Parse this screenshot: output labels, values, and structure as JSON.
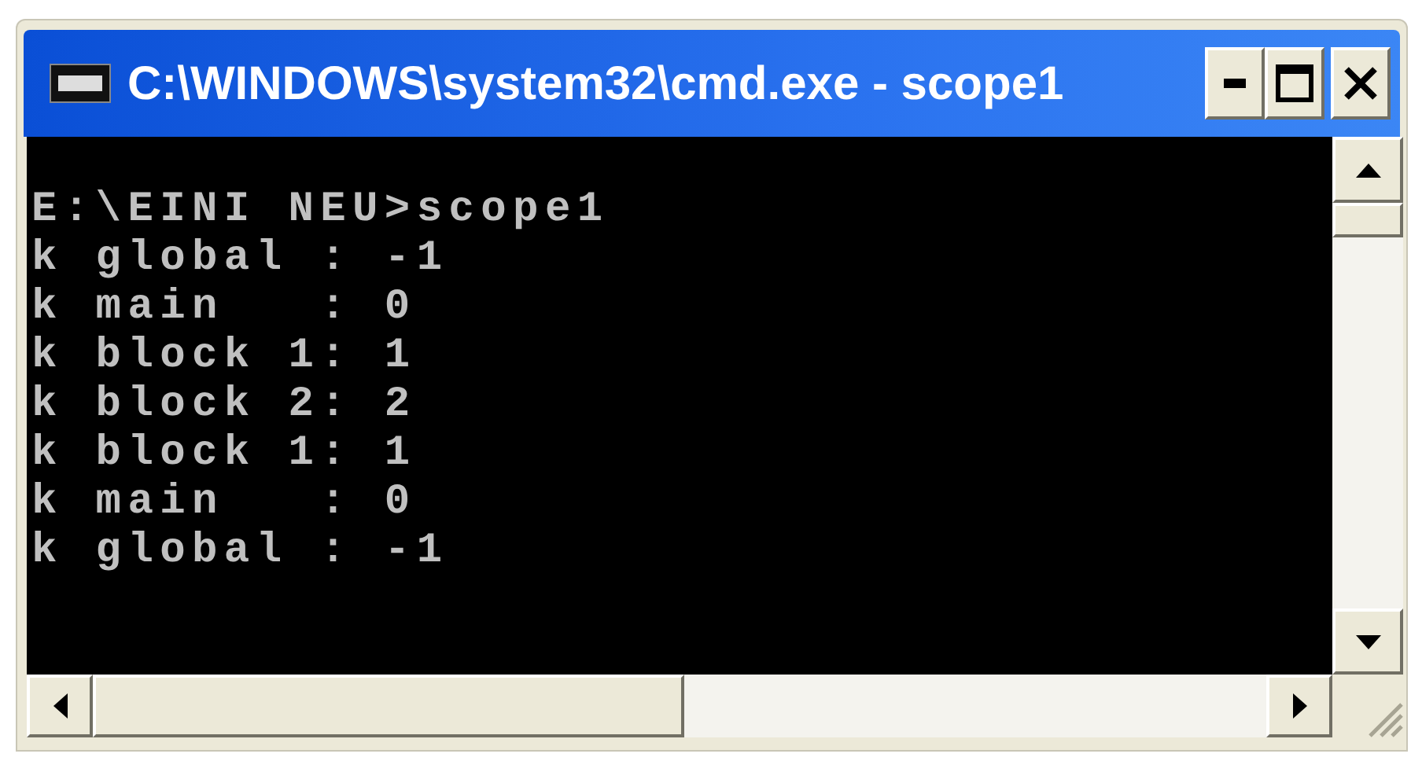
{
  "window": {
    "title": "C:\\WINDOWS\\system32\\cmd.exe - scope1"
  },
  "console": {
    "lines": [
      "E:\\EINI NEU>scope1",
      "k global : -1",
      "k main   : 0",
      "k block 1: 1",
      "k block 2: 2",
      "k block 1: 1",
      "k main   : 0",
      "k global : -1"
    ]
  }
}
